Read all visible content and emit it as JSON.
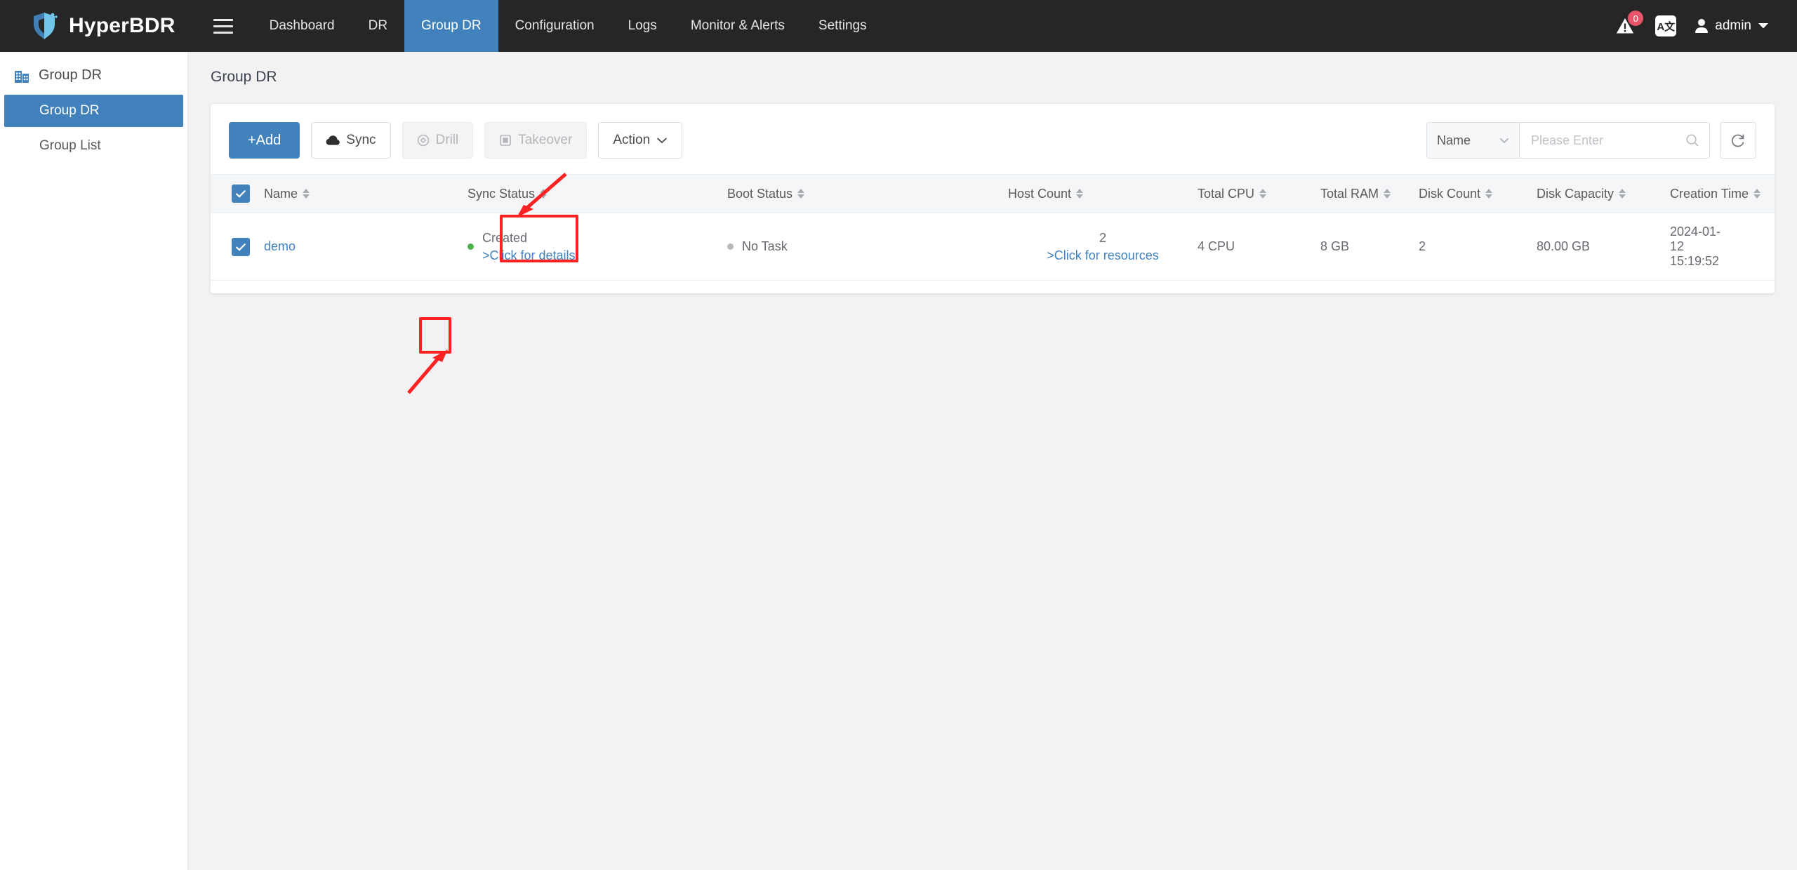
{
  "app": {
    "brand": "HyperBDR",
    "logo_colors": {
      "dark": "#3f7fb5",
      "light": "#6fc6e8"
    },
    "accent": "#4182bd",
    "annotation_color": "#ff2222"
  },
  "topnav": {
    "menu_toggle": "hamburger-menu",
    "links": [
      {
        "label": "Dashboard",
        "active": false
      },
      {
        "label": "DR",
        "active": false
      },
      {
        "label": "Group DR",
        "active": true
      },
      {
        "label": "Configuration",
        "active": false
      },
      {
        "label": "Logs",
        "active": false
      },
      {
        "label": "Monitor & Alerts",
        "active": false
      },
      {
        "label": "Settings",
        "active": false
      }
    ],
    "alerts": {
      "icon": "warning-icon",
      "count": "0",
      "badge_color": "#e8546a"
    },
    "language": {
      "icon": "translate-icon",
      "label": "A文"
    },
    "user": {
      "icon": "user-icon",
      "name": "admin",
      "chevron": "chevron-down-icon"
    }
  },
  "sidebar": {
    "section_icon": "building-icon",
    "section_title": "Group DR",
    "items": [
      {
        "label": "Group DR",
        "active": true
      },
      {
        "label": "Group List",
        "active": false
      }
    ]
  },
  "main": {
    "page_title": "Group DR",
    "toolbar": {
      "add_label": "+Add",
      "sync_label": "Sync",
      "sync_icon": "cloud-icon",
      "drill_label": "Drill",
      "drill_icon": "drill-icon",
      "takeover_label": "Takeover",
      "takeover_icon": "takeover-icon",
      "action_label": "Action",
      "action_chevron": "chevron-down-icon"
    },
    "search": {
      "field_selected": "Name",
      "field_chevron": "chevron-down-icon",
      "placeholder": "Please Enter",
      "value": "",
      "search_icon": "search-icon",
      "refresh_icon": "refresh-icon"
    },
    "table": {
      "select_all_checked": true,
      "columns": [
        {
          "label": "Name",
          "sortable": true
        },
        {
          "label": "Sync Status",
          "sortable": true
        },
        {
          "label": "Boot Status",
          "sortable": true
        },
        {
          "label": "Host Count",
          "sortable": true
        },
        {
          "label": "Total CPU",
          "sortable": true
        },
        {
          "label": "Total RAM",
          "sortable": true
        },
        {
          "label": "Disk Count",
          "sortable": true
        },
        {
          "label": "Disk Capacity",
          "sortable": true
        },
        {
          "label": "Creation Time",
          "sortable": true
        }
      ],
      "rows": [
        {
          "checked": true,
          "name": "demo",
          "sync_status": "Created",
          "sync_status_link": ">Click for details",
          "sync_status_color": "green",
          "boot_status": "No Task",
          "boot_status_color": "grey",
          "host_count": "2",
          "host_count_link": ">Click for resources",
          "total_cpu": "4 CPU",
          "total_ram": "8 GB",
          "disk_count": "2",
          "disk_capacity": "80.00 GB",
          "creation_time": "2024-01-12 15:19:52"
        }
      ]
    }
  },
  "annotations": [
    {
      "name": "highlight-sync-button",
      "shape": "rectangle"
    },
    {
      "name": "pointer-to-sync-button",
      "shape": "arrow"
    },
    {
      "name": "highlight-row-checkbox",
      "shape": "rectangle"
    },
    {
      "name": "pointer-to-row-checkbox",
      "shape": "arrow"
    }
  ]
}
